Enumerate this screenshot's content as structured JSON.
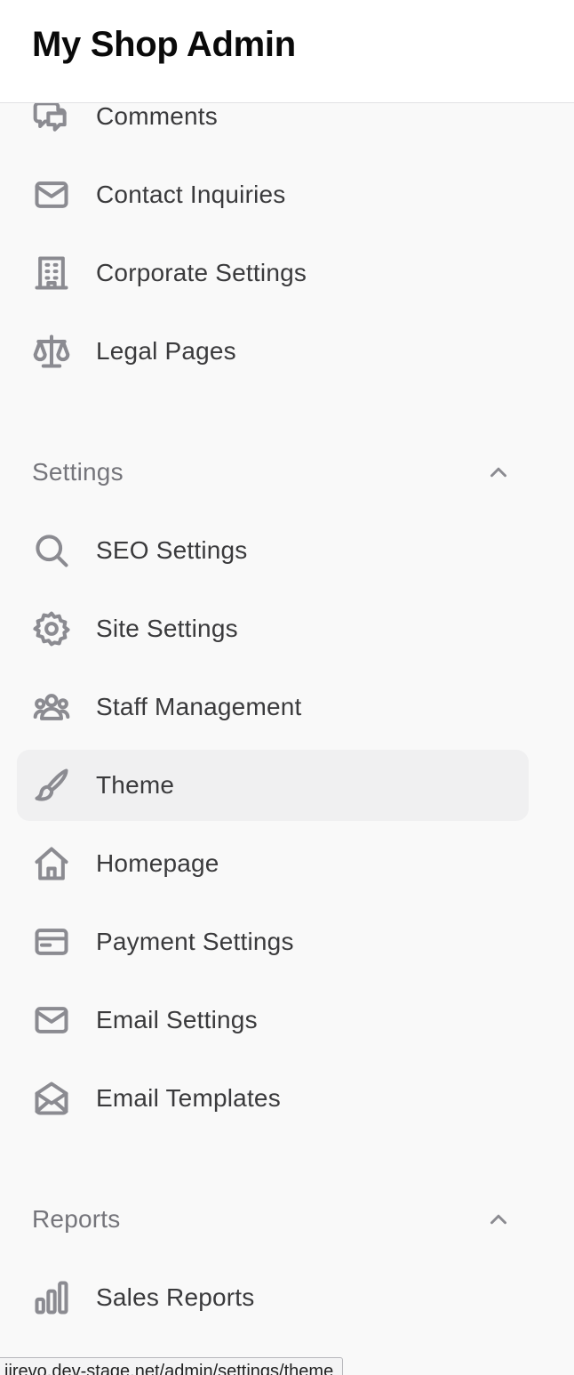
{
  "app": {
    "title": "My Shop Admin"
  },
  "sidebar": {
    "top_items": [
      {
        "label": "Comments",
        "icon": "comments-icon"
      },
      {
        "label": "Contact Inquiries",
        "icon": "mail-icon"
      },
      {
        "label": "Corporate Settings",
        "icon": "building-icon"
      },
      {
        "label": "Legal Pages",
        "icon": "scale-icon"
      }
    ],
    "settings": {
      "title": "Settings",
      "items": [
        {
          "label": "SEO Settings",
          "icon": "search-icon"
        },
        {
          "label": "Site Settings",
          "icon": "gear-icon"
        },
        {
          "label": "Staff Management",
          "icon": "users-icon"
        },
        {
          "label": "Theme",
          "icon": "brush-icon",
          "active": true
        },
        {
          "label": "Homepage",
          "icon": "home-icon"
        },
        {
          "label": "Payment Settings",
          "icon": "credit-card-icon"
        },
        {
          "label": "Email Settings",
          "icon": "mail-icon"
        },
        {
          "label": "Email Templates",
          "icon": "mail-open-icon"
        }
      ]
    },
    "reports": {
      "title": "Reports",
      "items": [
        {
          "label": "Sales Reports",
          "icon": "bar-chart-icon"
        }
      ]
    }
  },
  "status_bar": {
    "url": "jirevo.dev-stage.net/admin/settings/theme"
  },
  "colors": {
    "active_bg": "#f0f0f1",
    "icon": "#8b8b91",
    "header_bg": "#ffffff",
    "sidebar_bg": "#f9f9f9"
  }
}
